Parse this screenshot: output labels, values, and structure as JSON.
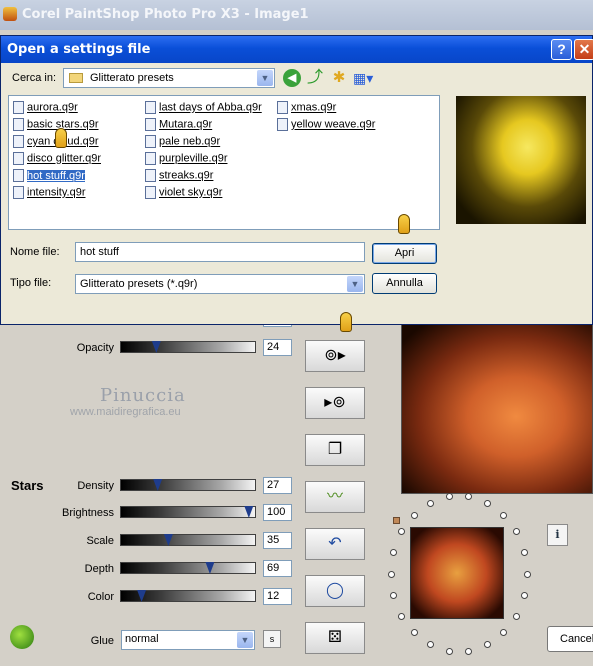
{
  "app": {
    "title": "Corel PaintShop Photo Pro X3 - Image1"
  },
  "dialog": {
    "title": "Open a settings file",
    "help_label": "?",
    "close_label": "✕",
    "look_in_label": "Cerca in:",
    "look_in_value": "Glitterato presets",
    "files": [
      "aurora.q9r",
      "basic stars.q9r",
      "cyan cloud.q9r",
      "disco glitter.q9r",
      "hot stuff.q9r",
      "intensity.q9r",
      "last days of Abba.q9r",
      "Mutara.q9r",
      "pale neb.q9r",
      "purpleville.q9r",
      "streaks.q9r",
      "violet sky.q9r",
      "xmas.q9r",
      "yellow weave.q9r"
    ],
    "selected_file": "hot stuff.q9r",
    "file_name_label": "Nome file:",
    "file_name_value": "hot stuff",
    "file_type_label": "Tipo file:",
    "file_type_value": "Glitterato presets (*.q9r)",
    "open_label": "Apri",
    "cancel_label": "Annulla"
  },
  "panel": {
    "opacity": {
      "label": "Opacity",
      "value": "24"
    },
    "watermark": {
      "title": "Pinuccia",
      "subtitle": "www.maidiregrafica.eu"
    },
    "stars_heading": "Stars",
    "sliders": [
      {
        "label": "Density",
        "value": "27"
      },
      {
        "label": "Brightness",
        "value": "100"
      },
      {
        "label": "Scale",
        "value": "35"
      },
      {
        "label": "Depth",
        "value": "69"
      },
      {
        "label": "Color",
        "value": "12"
      }
    ],
    "glue": {
      "label": "Glue",
      "value": "normal",
      "s_button": "s"
    },
    "cancel_label": "Cancel",
    "info_label": "i"
  },
  "icons": {
    "save_preset": "⊚▸",
    "load_preset": "▸⊚",
    "copy": "❐",
    "wave": "〰",
    "undo": "↶",
    "circle": "◯",
    "dice": "⚄"
  },
  "colors": {
    "dialog_title": "#0a4fd8",
    "selection": "#316ac5",
    "slider_thumb": "#1e3c8c"
  }
}
